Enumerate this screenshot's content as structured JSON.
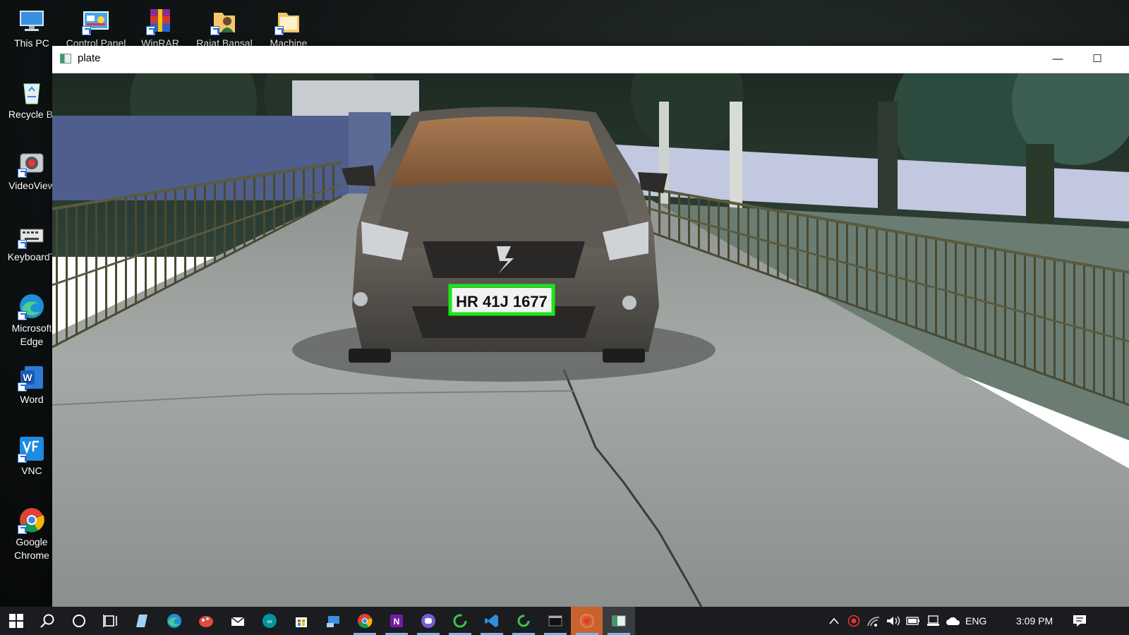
{
  "desktop": {
    "icons": [
      {
        "label": "This PC",
        "icon": "pc-icon"
      },
      {
        "label": "Control Panel",
        "icon": "control-panel-icon"
      },
      {
        "label": "WinRAR",
        "icon": "winrar-icon"
      },
      {
        "label": "Rajat Bansal",
        "icon": "user-folder-icon"
      },
      {
        "label": "Machine",
        "icon": "folder-icon"
      },
      {
        "label": "Recycle Bi",
        "icon": "recycle-bin-icon"
      },
      {
        "label": "VideoView",
        "icon": "video-viewer-icon"
      },
      {
        "label": "KeyboardT",
        "icon": "keyboard-icon"
      },
      {
        "label": "Microsoft",
        "label2": "Edge",
        "icon": "edge-icon"
      },
      {
        "label": "Word",
        "icon": "word-icon"
      },
      {
        "label": "VNC",
        "icon": "vnc-icon"
      },
      {
        "label": "Google",
        "label2": "Chrome",
        "icon": "chrome-icon"
      }
    ]
  },
  "window": {
    "title": "plate",
    "minimize_glyph": "—",
    "maximize_glyph": "☐"
  },
  "scene": {
    "plate_text": "HR 41J 1677",
    "detection_box_color": "#19e619",
    "plate_detected": true
  },
  "taskbar": {
    "apps": [
      "start",
      "search",
      "cortana",
      "task-view",
      "notepad",
      "edge",
      "paint",
      "mail",
      "arduino",
      "store",
      "remote",
      "chrome",
      "onenote",
      "discord",
      "spinner",
      "vscode",
      "spinner-2",
      "terminal",
      "record",
      "plate-viewer"
    ],
    "language": "ENG",
    "time": "3:09 PM"
  }
}
